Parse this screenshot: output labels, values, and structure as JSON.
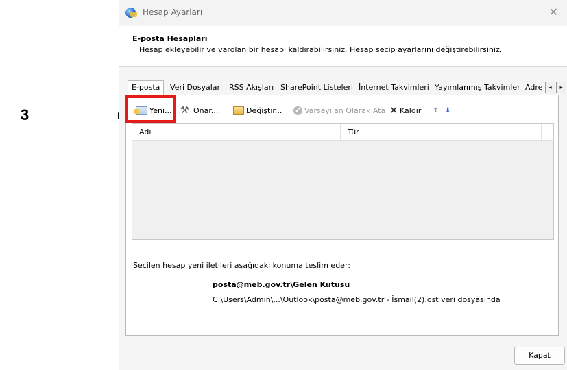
{
  "annotation": {
    "step_number": "3",
    "highlight_color": "#e41b1b"
  },
  "window": {
    "title": "Hesap Ayarları",
    "close_glyph": "✕",
    "header_title": "E-posta Hesapları",
    "header_desc": "Hesap ekleyebilir ve varolan bir hesabı kaldırabilirsiniz. Hesap seçip ayarlarını değiştirebilirsiniz."
  },
  "tabs": [
    {
      "label": "E-posta",
      "active": true
    },
    {
      "label": "Veri Dosyaları"
    },
    {
      "label": "RSS Akışları"
    },
    {
      "label": "SharePoint Listeleri"
    },
    {
      "label": "İnternet Takvimleri"
    },
    {
      "label": "Yayımlanmış Takvimler"
    },
    {
      "label": "Adre"
    }
  ],
  "tab_scroll": {
    "left": "◂",
    "right": "▸"
  },
  "toolbar": {
    "new_label": "Yeni...",
    "repair_label": "Onar...",
    "change_label": "Değiştir...",
    "default_label": "Varsayılan Olarak Ata",
    "remove_label": "Kaldır",
    "up_glyph": "⬆",
    "down_glyph": "⬇",
    "repair_icon_glyph": "⚒",
    "check_glyph": "✔",
    "x_glyph": "✕"
  },
  "list": {
    "columns": [
      "Adı",
      "Tür"
    ]
  },
  "delivery": {
    "intro": "Seçilen hesap yeni iletileri aşağıdaki konuma teslim eder:",
    "folder": "posta@meb.gov.tr\\Gelen Kutusu",
    "path": "C:\\Users\\Admin\\...\\Outlook\\posta@meb.gov.tr - İsmail(2).ost veri dosyasında"
  },
  "footer": {
    "close_label": "Kapat"
  }
}
